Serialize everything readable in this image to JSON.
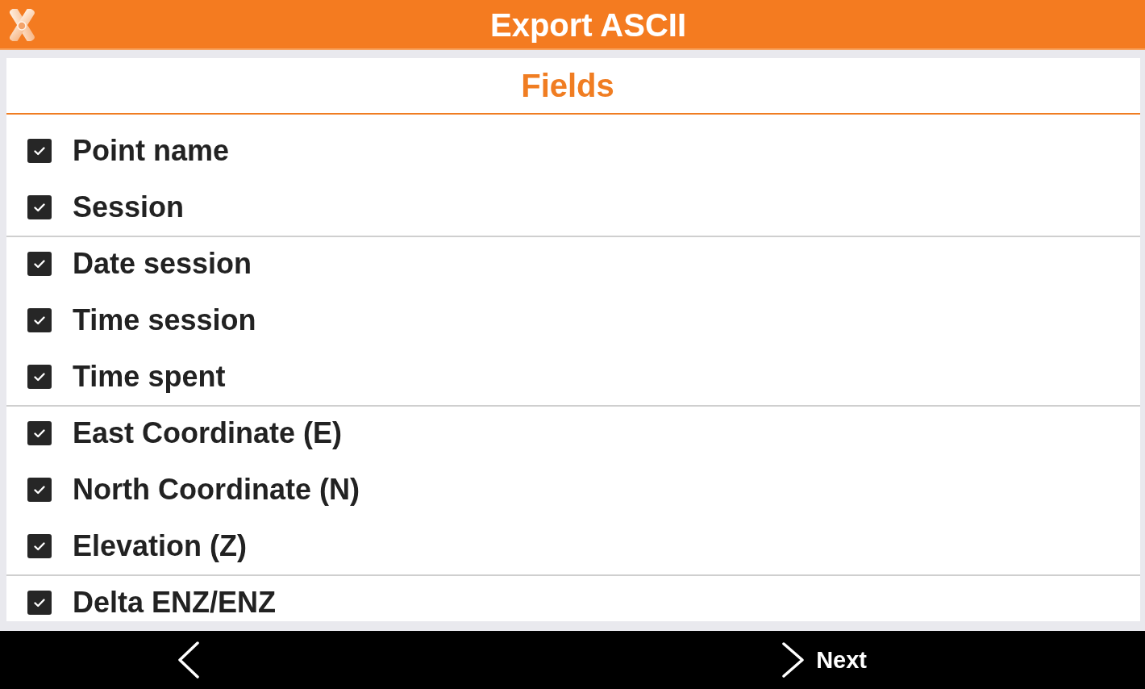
{
  "window": {
    "title": "Export ASCII"
  },
  "section": {
    "title": "Fields"
  },
  "groups": [
    {
      "items": [
        {
          "label": "Point name",
          "checked": true
        },
        {
          "label": "Session",
          "checked": true
        }
      ]
    },
    {
      "items": [
        {
          "label": "Date session",
          "checked": true
        },
        {
          "label": "Time session",
          "checked": true
        },
        {
          "label": "Time spent",
          "checked": true
        }
      ]
    },
    {
      "items": [
        {
          "label": "East Coordinate (E)",
          "checked": true
        },
        {
          "label": "North Coordinate (N)",
          "checked": true
        },
        {
          "label": "Elevation (Z)",
          "checked": true
        }
      ]
    },
    {
      "items": [
        {
          "label": "Delta ENZ/ENZ",
          "checked": true
        }
      ]
    }
  ],
  "nav": {
    "next": {
      "label": "Next"
    }
  }
}
